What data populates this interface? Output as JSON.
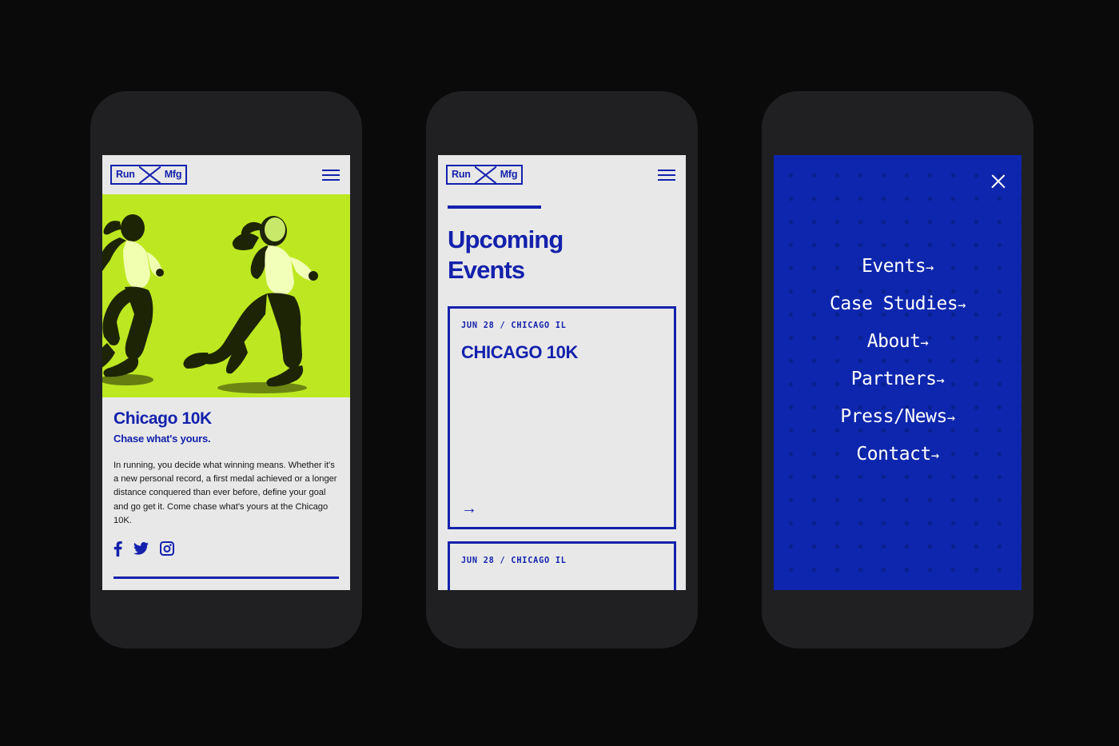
{
  "colors": {
    "brand_blue": "#1421ac",
    "menu_blue": "#0d26ad",
    "hero_green": "#bde821",
    "screen_bg": "#e8e8e8",
    "frame": "#202022",
    "page_bg": "#0a0a0b",
    "white": "#ffffff"
  },
  "brand": {
    "logo_left": "Run",
    "logo_right": "Mfg",
    "logo_divider_icon": "x-mark-icon",
    "menu_icon": "hamburger-icon"
  },
  "screen_event": {
    "hero_image_alt": "two-female-runners-duotone",
    "title": "Chicago 10K",
    "subtitle": "Chase what's yours.",
    "body": "In running, you decide what winning means. Whether it's a new personal record, a first medal achieved or a longer distance conquered than ever before, define your goal and go get it. Come chase what's yours at the Chicago 10K.",
    "socials": [
      {
        "name": "facebook-icon",
        "label": "Facebook"
      },
      {
        "name": "twitter-icon",
        "label": "Twitter"
      },
      {
        "name": "instagram-icon",
        "label": "Instagram"
      }
    ]
  },
  "screen_events": {
    "heading_line1": "Upcoming",
    "heading_line2": "Events",
    "cards": [
      {
        "meta": "JUN 28 / CHICAGO IL",
        "name": "CHICAGO 10K",
        "arrow": "→"
      },
      {
        "meta": "JUN 28 / CHICAGO IL",
        "name": "",
        "arrow": "→"
      }
    ]
  },
  "screen_menu": {
    "close_icon": "close-icon",
    "items": [
      {
        "label": "Events",
        "arrow": "→"
      },
      {
        "label": "Case Studies",
        "arrow": "→"
      },
      {
        "label": "About",
        "arrow": "→"
      },
      {
        "label": "Partners",
        "arrow": "→"
      },
      {
        "label": "Press/News",
        "arrow": "→"
      },
      {
        "label": "Contact",
        "arrow": "→"
      }
    ]
  }
}
